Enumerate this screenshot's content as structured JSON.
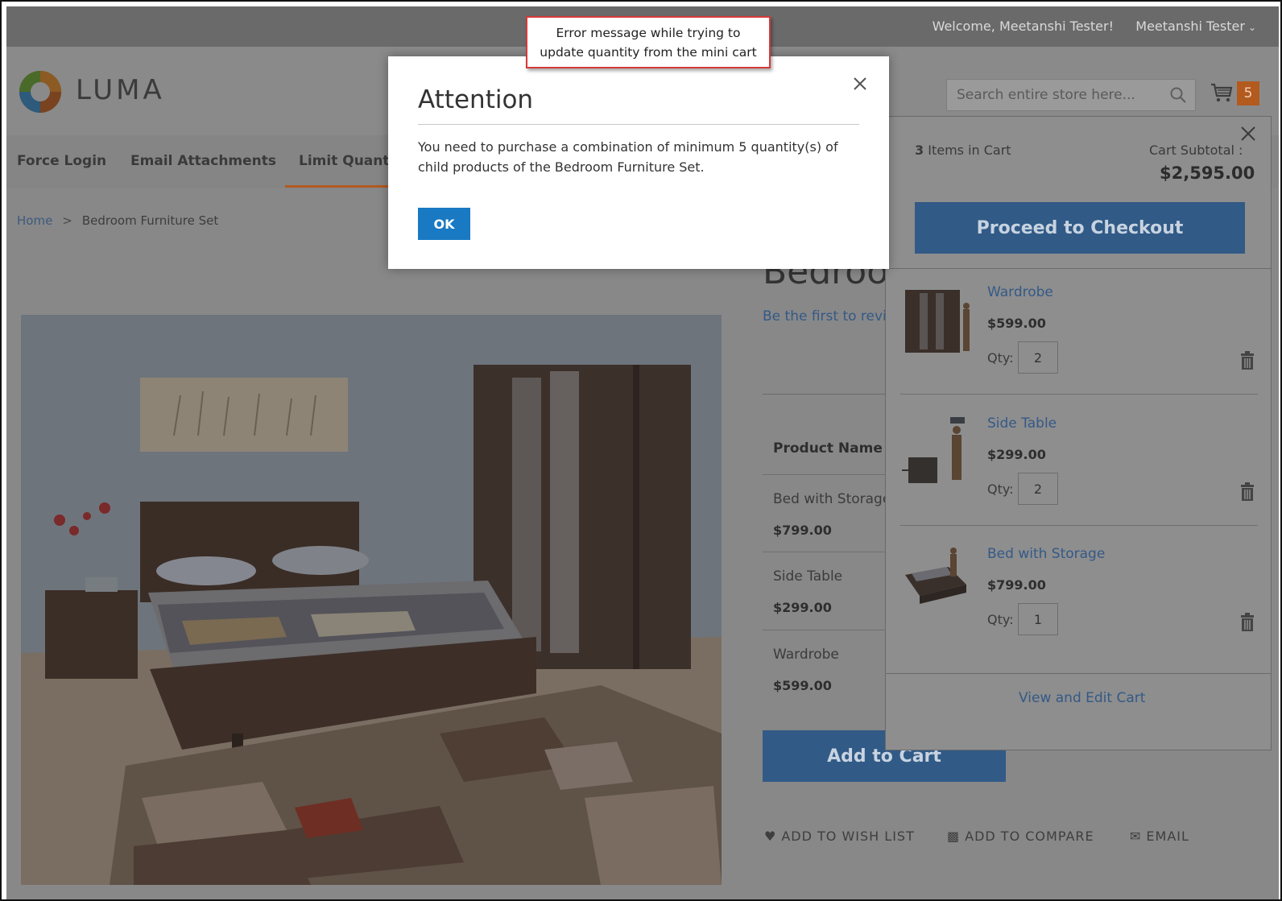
{
  "panel_top": {
    "welcome": "Welcome, Meetanshi Tester!",
    "account": "Meetanshi Tester"
  },
  "header": {
    "logo_text": "LUMA",
    "search_placeholder": "Search entire store here...",
    "cart_count": "5"
  },
  "nav": {
    "items": [
      "Force Login",
      "Email Attachments",
      "Limit Quanti"
    ]
  },
  "breadcrumb": {
    "home": "Home",
    "separator": ">",
    "current": "Bedroom Furniture Set"
  },
  "product": {
    "title_fragment": "Bedroo",
    "review_link": "Be the first to revie",
    "column_header": "Product Name",
    "rows": [
      {
        "name": "Bed with Storage",
        "price": "$799.00"
      },
      {
        "name": "Side Table",
        "price": "$299.00"
      },
      {
        "name": "Wardrobe",
        "price": "$599.00"
      }
    ],
    "add_to_cart": "Add to Cart",
    "actions": {
      "wishlist": "ADD TO WISH LIST",
      "compare": "ADD TO COMPARE",
      "email": "EMAIL"
    }
  },
  "minicart": {
    "items_count": "3",
    "items_label": "Items in Cart",
    "subtotal_label": "Cart Subtotal :",
    "subtotal_value": "$2,595.00",
    "checkout": "Proceed to Checkout",
    "qty_label": "Qty:",
    "items": [
      {
        "name": "Wardrobe",
        "price": "$599.00",
        "qty": "2"
      },
      {
        "name": "Side Table",
        "price": "$299.00",
        "qty": "2"
      },
      {
        "name": "Bed with Storage",
        "price": "$799.00",
        "qty": "1"
      }
    ],
    "view_edit": "View and Edit Cart"
  },
  "modal": {
    "title": "Attention",
    "message": "You need to purchase a combination of minimum 5 quantity(s) of child products of the Bedroom Furniture Set.",
    "ok": "OK"
  },
  "callout": {
    "line1": "Error message while trying to",
    "line2": "update quantity from the mini cart"
  },
  "colors": {
    "accent_blue": "#1979c3",
    "link_blue": "#345987",
    "luma_orange": "#b35a1f",
    "callout_border": "#d63a3a"
  }
}
